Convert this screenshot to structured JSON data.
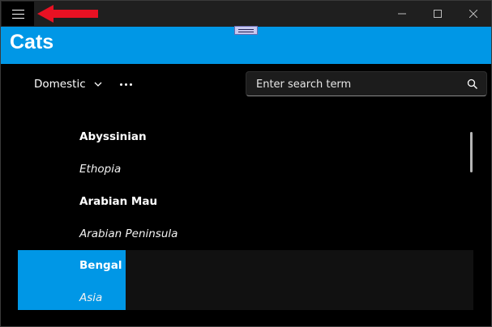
{
  "header": {
    "title": "Cats"
  },
  "toolbar": {
    "filter_selected": "Domestic",
    "search_placeholder": "Enter search term"
  },
  "list": {
    "items": [
      {
        "name": "Abyssinian",
        "origin": "Ethopia",
        "selected": false
      },
      {
        "name": "Arabian Mau",
        "origin": "Arabian Peninsula",
        "selected": false
      },
      {
        "name": "Bengal",
        "origin": "Asia",
        "selected": true
      }
    ]
  },
  "colors": {
    "accent": "#0097e6",
    "titlebar": "#1f1f1f",
    "background": "#000000",
    "annotation_arrow": "#e81123"
  },
  "icons": {
    "menu": "hamburger-icon",
    "filter": "chevron-down-icon",
    "more": "more-icon",
    "search": "search-icon",
    "minimize": "minimize-icon",
    "maximize": "maximize-icon",
    "close": "close-icon",
    "annotation": "red-arrow-icon"
  }
}
